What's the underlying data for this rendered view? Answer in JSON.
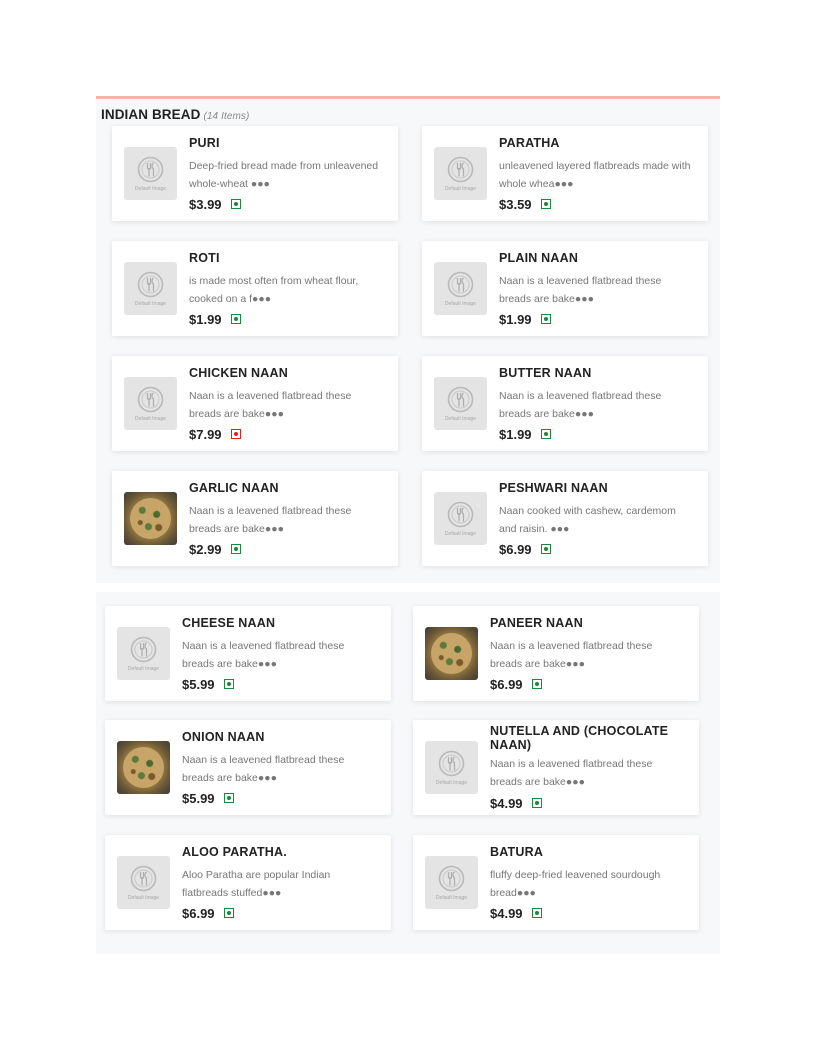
{
  "section": {
    "title": "INDIAN BREAD",
    "count": "(14 Items)"
  },
  "placeholder_label": "Default Image",
  "colors": {
    "veg": "#1a8a3a",
    "nonveg": "#dd2222",
    "accent_line": "#f4b3a5"
  },
  "items": [
    {
      "name": "PURI",
      "desc": "Deep-fried bread made from unleavened whole-wheat ●●●",
      "price": "$3.99",
      "type": "veg",
      "image": "placeholder"
    },
    {
      "name": "PARATHA",
      "desc": "unleavened layered flatbreads made with whole whea●●●",
      "price": "$3.59",
      "type": "veg",
      "image": "placeholder"
    },
    {
      "name": "ROTI",
      "desc": "is made most often from wheat flour, cooked on a f●●●",
      "price": "$1.99",
      "type": "veg",
      "image": "placeholder"
    },
    {
      "name": "PLAIN NAAN",
      "desc": "Naan is a leavened flatbread these breads are bake●●●",
      "price": "$1.99",
      "type": "veg",
      "image": "placeholder"
    },
    {
      "name": "CHICKEN NAAN",
      "desc": "Naan is a leavened flatbread these breads are bake●●●",
      "price": "$7.99",
      "type": "nonveg",
      "image": "placeholder"
    },
    {
      "name": "BUTTER NAAN",
      "desc": "Naan is a leavened flatbread these breads are bake●●●",
      "price": "$1.99",
      "type": "veg",
      "image": "placeholder"
    },
    {
      "name": "GARLIC NAAN",
      "desc": "Naan is a leavened flatbread these breads are bake●●●",
      "price": "$2.99",
      "type": "veg",
      "image": "photo"
    },
    {
      "name": "PESHWARI NAAN",
      "desc": "Naan cooked with cashew, cardemom and raisin. ●●●",
      "price": "$6.99",
      "type": "veg",
      "image": "placeholder"
    },
    {
      "name": "CHEESE NAAN",
      "desc": "Naan is a leavened flatbread these breads are bake●●●",
      "price": "$5.99",
      "type": "veg",
      "image": "placeholder"
    },
    {
      "name": "PANEER NAAN",
      "desc": "Naan is a leavened flatbread these breads are bake●●●",
      "price": "$6.99",
      "type": "veg",
      "image": "photo"
    },
    {
      "name": "ONION NAAN",
      "desc": "Naan is a leavened flatbread these breads are bake●●●",
      "price": "$5.99",
      "type": "veg",
      "image": "photo"
    },
    {
      "name": "NUTELLA AND (CHOCOLATE NAAN)",
      "desc": "Naan is a leavened flatbread these breads are bake●●●",
      "price": "$4.99",
      "type": "veg",
      "image": "placeholder"
    },
    {
      "name": "ALOO PARATHA.",
      "desc": "Aloo Paratha are popular Indian flatbreads stuffed●●●",
      "price": "$6.99",
      "type": "veg",
      "image": "placeholder"
    },
    {
      "name": "BATURA",
      "desc": "fluffy deep-fried leavened sourdough bread●●●",
      "price": "$4.99",
      "type": "veg",
      "image": "placeholder"
    }
  ]
}
